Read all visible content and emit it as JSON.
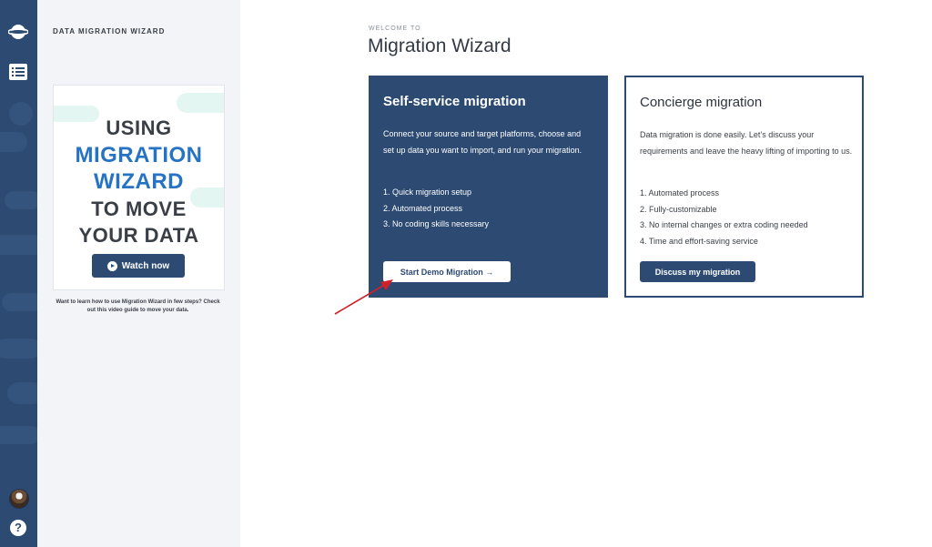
{
  "sidebar": {
    "title": "DATA MIGRATION WIZARD",
    "video": {
      "line1": "USING",
      "line2": "MIGRATION",
      "line3": "WIZARD",
      "line4": "TO MOVE",
      "line5": "YOUR DATA",
      "watch_label": "Watch now"
    },
    "caption": "Want to learn how to use Migration Wizard in few steps? Check out this video guide to move your data."
  },
  "rail": {
    "logo_icon": "planet-logo-icon",
    "list_icon": "list-icon",
    "help_label": "?"
  },
  "main": {
    "welcome": "WELCOME TO",
    "title": "Migration Wizard",
    "self_service": {
      "title": "Self-service migration",
      "description": "Connect your source and target platforms, choose and set up data you want to import, and run your migration.",
      "items": [
        "1. Quick migration setup",
        "2. Automated process",
        "3. No coding skills necessary"
      ],
      "button": "Start Demo Migration →"
    },
    "concierge": {
      "title": "Concierge migration",
      "description": "Data migration is done easily. Let’s discuss your requirements and leave the heavy lifting of importing to us.",
      "items": [
        "1. Automated process",
        "2. Fully-customizable",
        "3. No internal changes or extra coding needed",
        "4. Time and effort-saving service"
      ],
      "button": "Discuss my migration"
    }
  },
  "colors": {
    "navy": "#2c4a72",
    "accent_blue": "#2673c4",
    "annotation_red": "#d0202a"
  }
}
